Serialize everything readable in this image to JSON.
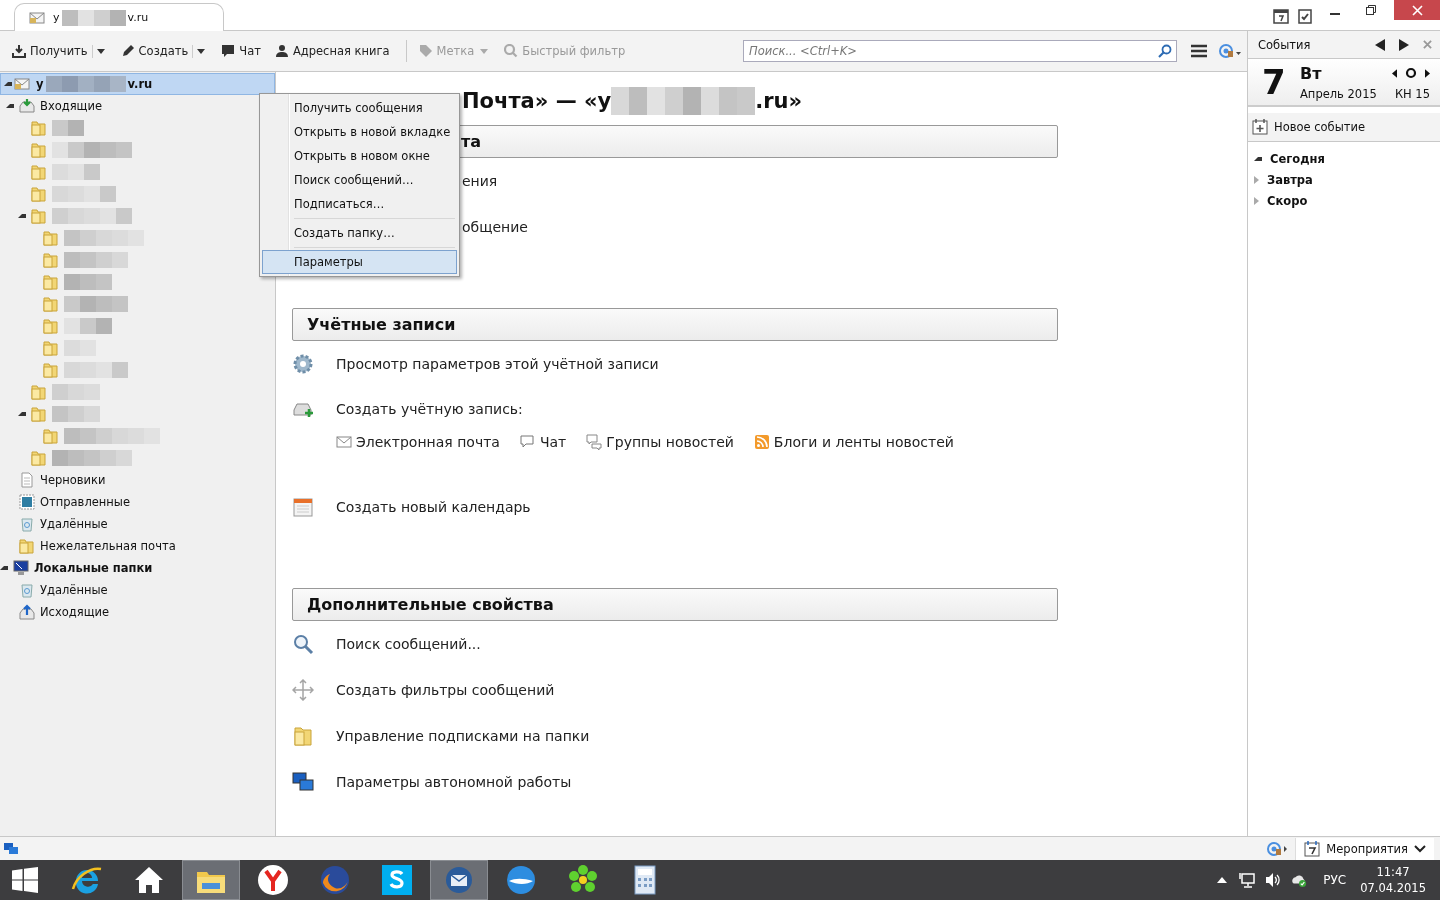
{
  "title_bar": {
    "tab": {
      "title_start": "y",
      "title_end": "v.ru"
    }
  },
  "toolbar": {
    "buttons": [
      {
        "kind": "get",
        "label": "Получить",
        "dropdown": true,
        "disabled": false
      },
      {
        "kind": "write",
        "label": "Создать",
        "dropdown": true,
        "disabled": false
      },
      {
        "kind": "chat",
        "label": "Чат",
        "dropdown": false,
        "disabled": false
      },
      {
        "kind": "address",
        "label": "Адресная книга",
        "dropdown": false,
        "disabled": false
      },
      {
        "kind": "tag",
        "label": "Метка",
        "dropdown": true,
        "disabled": true
      },
      {
        "kind": "filter",
        "label": "Быстрый фильтр",
        "dropdown": false,
        "disabled": true
      }
    ],
    "search": {
      "placeholder": "Поиск... <Ctrl+K>"
    }
  },
  "folder_pane": {
    "account": {
      "name_start": "y",
      "name_end": "v.ru",
      "selected": true,
      "expanded": true
    },
    "folders": [
      {
        "kind": "inbox",
        "label": "Входящие",
        "expanded": true,
        "children": [
          {
            "kind": "redacted"
          },
          {
            "kind": "redacted"
          },
          {
            "kind": "redacted"
          },
          {
            "kind": "redacted"
          },
          {
            "kind": "redacted",
            "expanded": true,
            "children": [
              {
                "kind": "redacted"
              },
              {
                "kind": "redacted"
              },
              {
                "kind": "redacted"
              },
              {
                "kind": "redacted"
              },
              {
                "kind": "redacted"
              },
              {
                "kind": "redacted"
              },
              {
                "kind": "redacted"
              }
            ]
          },
          {
            "kind": "redacted"
          },
          {
            "kind": "redacted",
            "expanded": true,
            "children": [
              {
                "kind": "redacted"
              }
            ]
          },
          {
            "kind": "redacted"
          }
        ]
      },
      {
        "kind": "drafts",
        "label": "Черновики"
      },
      {
        "kind": "sent",
        "label": "Отправленные"
      },
      {
        "kind": "trash",
        "label": "Удалённые"
      },
      {
        "kind": "folder",
        "label": "Нежелательная почта"
      }
    ],
    "local": {
      "label": "Локальные папки",
      "expanded": true,
      "folders": [
        {
          "kind": "trash",
          "label": "Удалённые"
        },
        {
          "kind": "outbox",
          "label": "Исходящие"
        }
      ]
    }
  },
  "context_menu": {
    "items": [
      {
        "kind": "item",
        "label": "Получить сообщения",
        "selected": false
      },
      {
        "kind": "item",
        "label": "Открыть в новой вкладке",
        "selected": false
      },
      {
        "kind": "item",
        "label": "Открыть в новом окне",
        "selected": false
      },
      {
        "kind": "item",
        "label": "Поиск сообщений…",
        "selected": false
      },
      {
        "kind": "item",
        "label": "Подписаться…",
        "selected": false
      },
      {
        "kind": "separator"
      },
      {
        "kind": "item",
        "label": "Создать папку…",
        "selected": false
      },
      {
        "kind": "separator"
      },
      {
        "kind": "item",
        "label": "Параметры",
        "selected": true
      }
    ]
  },
  "content": {
    "heading": {
      "start": "Почта» — «у",
      "end": ".ru»",
      "partial": true
    },
    "sections": [
      {
        "title": "та",
        "partial": true,
        "items": [
          {
            "kind": "partial",
            "label": "ения"
          },
          {
            "kind": "partial",
            "label": "общение"
          }
        ]
      },
      {
        "title": "Учётные записи",
        "partial": false,
        "items": [
          {
            "kind": "settings",
            "label": "Просмотр параметров этой учётной записи"
          },
          {
            "kind": "new-account",
            "label": "Создать учётную запись:",
            "links": [
              {
                "kind": "mail",
                "label": "Электронная почта"
              },
              {
                "kind": "chat",
                "label": "Чат"
              },
              {
                "kind": "news",
                "label": "Группы новостей"
              },
              {
                "kind": "feed",
                "label": "Блоги и ленты новостей"
              }
            ]
          },
          {
            "kind": "calendar",
            "label": "Создать новый календарь"
          }
        ]
      },
      {
        "title": "Дополнительные свойства",
        "partial": false,
        "items": [
          {
            "kind": "search",
            "label": "Поиск сообщений..."
          },
          {
            "kind": "filters",
            "label": "Создать фильтры сообщений"
          },
          {
            "kind": "subscribe",
            "label": "Управление подписками на папки"
          },
          {
            "kind": "offline",
            "label": "Параметры автономной работы"
          }
        ]
      }
    ]
  },
  "today_pane": {
    "title": "События",
    "day": "7",
    "weekday": "Вт",
    "month": "Апрель 2015",
    "week": "КН 15",
    "new_event": "Новое событие",
    "groups": [
      {
        "label": "Сегодня",
        "expanded": true
      },
      {
        "label": "Завтра",
        "expanded": false
      },
      {
        "label": "Скоро",
        "expanded": false
      }
    ]
  },
  "status_bar": {
    "events_button": "Мероприятия"
  },
  "taskbar": {
    "apps": [
      {
        "kind": "ie",
        "selected": false
      },
      {
        "kind": "home",
        "selected": false
      },
      {
        "kind": "explorer",
        "selected": true
      },
      {
        "kind": "yandex",
        "selected": false
      },
      {
        "kind": "firefox",
        "selected": false
      },
      {
        "kind": "skype",
        "selected": false
      },
      {
        "kind": "thunderbird",
        "selected": true
      },
      {
        "kind": "bird",
        "selected": false
      },
      {
        "kind": "flower",
        "selected": false
      },
      {
        "kind": "calculator",
        "selected": false
      }
    ],
    "language": "РУС",
    "time": "11:47",
    "date": "07.04.2015"
  }
}
